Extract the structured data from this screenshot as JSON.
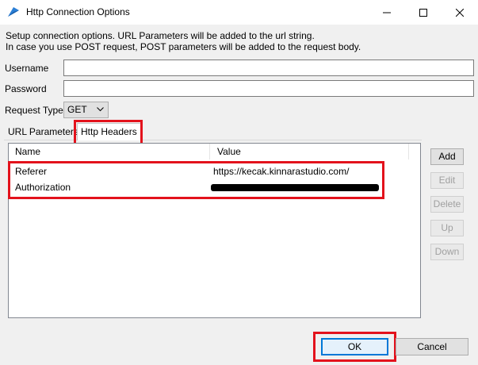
{
  "window": {
    "title": "Http Connection Options",
    "icon": "app-icon",
    "controls": [
      "minimize-icon",
      "maximize-icon",
      "close-icon"
    ]
  },
  "description": {
    "line1": "Setup connection options. URL Parameters will be added to the url string.",
    "line2": "In case you use POST request, POST parameters will be added to the request body."
  },
  "form": {
    "username_label": "Username",
    "username_value": "",
    "password_label": "Password",
    "password_value": "",
    "request_type_label": "Request Type",
    "request_type_value": "GET"
  },
  "tabs": [
    {
      "label": "URL Parameters",
      "active": false
    },
    {
      "label": "Http Headers",
      "active": true
    }
  ],
  "table": {
    "columns": [
      "Name",
      "Value"
    ],
    "rows": [
      {
        "name": "Referer",
        "value": "https://kecak.kinnarastudio.com/"
      },
      {
        "name": "Authorization",
        "value": ""
      }
    ]
  },
  "side_buttons": [
    {
      "label": "Add",
      "enabled": true
    },
    {
      "label": "Edit",
      "enabled": false
    },
    {
      "label": "Delete",
      "enabled": false
    },
    {
      "label": "Up",
      "enabled": false
    },
    {
      "label": "Down",
      "enabled": false
    }
  ],
  "footer": {
    "ok_label": "OK",
    "cancel_label": "Cancel"
  },
  "colors": {
    "highlight": "#e3121c",
    "accent": "#0078d7",
    "window_bg": "#f0f0f0"
  }
}
